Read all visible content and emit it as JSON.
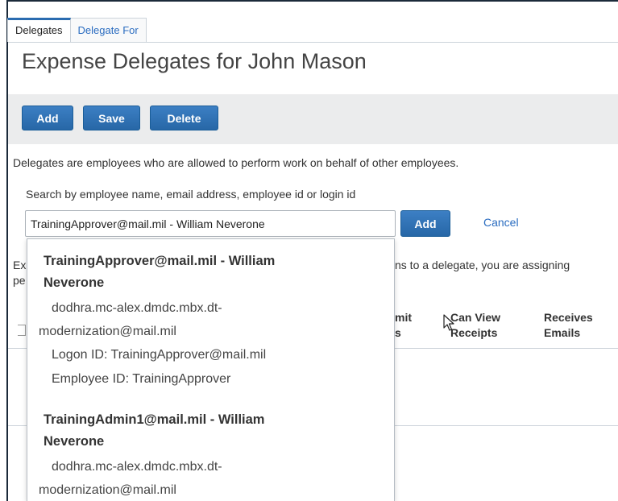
{
  "tabs": [
    {
      "label": "Delegates",
      "active": true
    },
    {
      "label": "Delegate For",
      "active": false
    }
  ],
  "page_title": "Expense Delegates for John Mason",
  "toolbar": {
    "add_label": "Add",
    "save_label": "Save",
    "delete_label": "Delete"
  },
  "description": "Delegates are employees who are allowed to perform work on behalf of other employees.",
  "search": {
    "label": "Search by employee name, email address, employee id or login id",
    "value": "TrainingApprover@mail.mil - William Neverone",
    "add_label": "Add",
    "cancel_label": "Cancel"
  },
  "background": {
    "text_fragment_1": "Ex",
    "text_fragment_2": "ns to a delegate, you are assigning",
    "text_fragment_3": "pe",
    "col_submit_line1": "mit",
    "col_submit_line2": "s",
    "col_receipts_line1": "Can View",
    "col_receipts_line2": "Receipts",
    "col_emails_line1": "Receives",
    "col_emails_line2": "Emails"
  },
  "suggestions": [
    {
      "name_line1": "TrainingApprover@mail.mil - William",
      "name_line2": "Neverone",
      "email_line1": "dodhra.mc-alex.dmdc.mbx.dt-",
      "email_line2": "modernization@mail.mil",
      "logon": "Logon ID: TrainingApprover@mail.mil",
      "employee": "Employee ID: TrainingApprover"
    },
    {
      "name_line1": "TrainingAdmin1@mail.mil - William",
      "name_line2": "Neverone",
      "email_line1": "dodhra.mc-alex.dmdc.mbx.dt-",
      "email_line2": "modernization@mail.mil"
    }
  ],
  "colors": {
    "accent": "#2b6cb0",
    "link": "#2a6cc0",
    "toolbar_bg": "#ebeced"
  },
  "icons": {
    "pointer": "mouse-pointer-icon"
  }
}
